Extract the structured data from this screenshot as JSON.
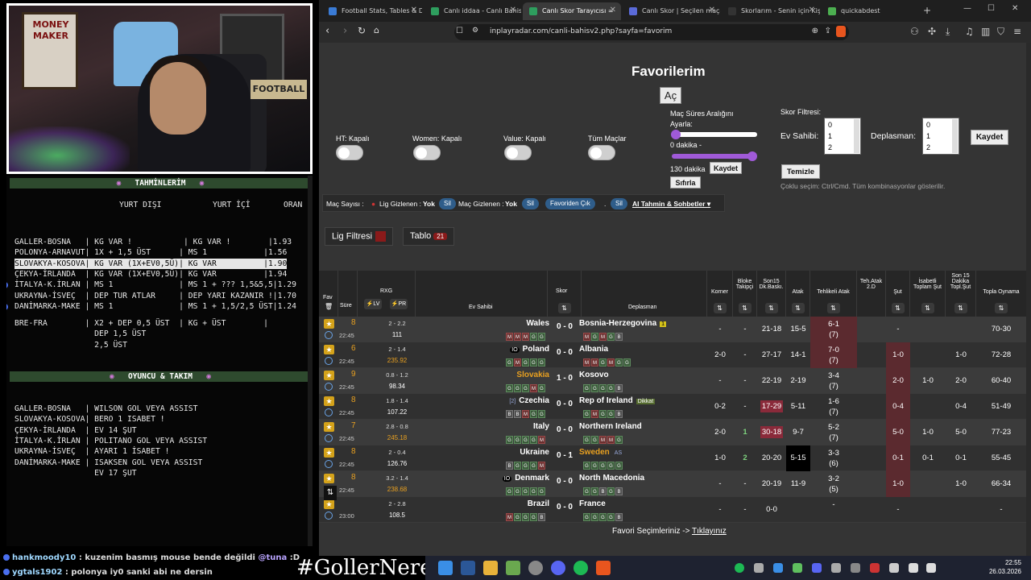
{
  "webcam": {
    "poster_text": "MONEY MAKER",
    "sign_text": "FOOTBALL"
  },
  "terminal": {
    "section1_title": "TAHMİNLERİM",
    "col_yurt_disi": "YURT DIŞI",
    "col_yurt_ici": "YURT İÇİ",
    "col_oran": "ORAN",
    "predictions": [
      {
        "text": "GALLER-BOSNA   | KG VAR !           | KG VAR !        |1.93",
        "hl": false,
        "dot": false
      },
      {
        "text": "POLONYA-ARNAVUT| 1X + 1,5 ÜST      | MS 1            |1.56",
        "hl": false,
        "dot": false
      },
      {
        "text": "SLOVAKYA-KOSOVA| KG VAR (1X+EV0,5Ü)| KG VAR          |1.90",
        "hl": true,
        "dot": false
      },
      {
        "text": "ÇEKYA-İRLANDA  | KG VAR (1X+EV0,5Ü)| KG VAR          |1.94",
        "hl": false,
        "dot": false
      },
      {
        "text": "İTALYA-K.İRLAN | MS 1              | MS 1 + ??? 1,5&5,5|1.29",
        "hl": false,
        "dot": true
      },
      {
        "text": "UKRAYNA-İSVEÇ  | DEP TUR ATLAR     | DEP YARI KAZANIR !|1.70",
        "hl": false,
        "dot": false
      },
      {
        "text": "DANİMARKA-MAKE | MS 1              | MS 1 + 1,5/2,5 ÜST|1.24",
        "hl": false,
        "dot": true
      }
    ],
    "bre_lines": [
      "BRE-FRA        | X2 + DEP 0,5 ÜST  | KG + ÜST        |",
      "                 DEP 1,5 ÜST",
      "                 2,5 ÜST"
    ],
    "section2_title": "OYUNCU & TAKIM",
    "players": [
      "GALLER-BOSNA   | WILSON GOL VEYA ASSIST",
      "SLOVAKYA-KOSOVA| BERO 1 ISABET !",
      "ÇEKYA-İRLANDA  | EV 14 ŞUT",
      "İTALYA-K.İRLAN | POLITANO GOL VEYA ASSIST",
      "UKRAYNA-İSVEÇ  | AYARI 1 İSABET !",
      "DANİMARKA-MAKE | ISAKSEN GOL VEYA ASSIST",
      "                 EV 17 ŞUT"
    ]
  },
  "chat": [
    {
      "nick": "hankmoody10",
      "msg": " : kuzenim basmış mouse bende değildi ",
      "mention": "@tuna",
      "tail": " :D"
    },
    {
      "nick": "ygtals1902",
      "msg": " : polonya iy0 sanki abi ne dersin",
      "mention": "",
      "tail": ""
    }
  ],
  "hashtag": "#GollerNerede",
  "browser": {
    "tabs": [
      {
        "label": "Football Stats, Tables & D",
        "color": "#3a7bd5"
      },
      {
        "label": "Canlı iddaa - Canlı Bahis",
        "color": "#2e9e5e"
      },
      {
        "label": "Canlı Skor Tarayıcısı =",
        "color": "#2e9e5e"
      },
      {
        "label": "Canlı Skor | Seçilen maça",
        "color": "#5a6ad8"
      },
      {
        "label": "Skorlarım - Senin için Kişi",
        "color": "#333"
      },
      {
        "label": "quickabdest",
        "color": "#4caf50"
      }
    ],
    "url": "inplayradar.com/canli-bahisv2.php?sayfa=favorim"
  },
  "page": {
    "title": "Favorilerim",
    "open_btn": "Aç",
    "toggles": [
      "HT: Kapalı",
      "Women: Kapalı",
      "Value: Kapalı",
      "Tüm Maçlar"
    ],
    "range_title": "Maç Süres Aralığını",
    "range_sub": "Ayarla:",
    "range_min": "0 dakika -",
    "range_max": "130 dakika",
    "save1": "Kaydet",
    "reset": "Sıfırla",
    "score_filter": "Skor Filtresi:",
    "home_label": "Ev Sahibi:",
    "away_label": "Deplasman:",
    "list_vals": [
      "0",
      "1",
      "2"
    ],
    "save2": "Kaydet",
    "clear": "Temizle",
    "multi_hint": "Çoklu seçim: Ctrl/Cmd. Tüm kombinasyonlar gösterilir.",
    "filter_bar": {
      "mac_sayisi": "Maç Sayısı :",
      "lig_gizlenen": "Lig Gizlenen :",
      "yok1": "Yok",
      "sil": "Sil",
      "mac_gizlenen": "Maç Gizlenen :",
      "yok2": "Yok",
      "favori_cik": "Favoriden Çık",
      "ai": "AI Tahmin & Sohbetler ▾"
    },
    "lig_filtresi": "Lig Filtresi",
    "tablo": "Tablo",
    "tablo_count": "21",
    "headers": {
      "fav": "Fav",
      "sure": "Süre",
      "rxg": "RXG",
      "lv": "⚡LV",
      "pr": "⚡PR",
      "ev": "Ev Sahibi",
      "skor": "Skor",
      "dep": "Deplasman",
      "korner": "Korner",
      "bloke": "Bloke Takipçi",
      "son15": "Son15 Dk.Baskı.",
      "atak": "Atak",
      "tehlikeli": "Tehlikeli Atak",
      "teh2d": "Teh.Atak 2.D",
      "sut": "Şut",
      "isabetli": "İsabetli Toplam Şut",
      "son15sut": "Son 15 Dakika Topl.Şut",
      "topla": "Topla Oynama"
    },
    "matches": [
      {
        "min": "8",
        "time": "22:45",
        "rxg1": "2 - 2.2",
        "rxg2": "111",
        "rxgc": "#fff",
        "home": "Wales",
        "homec": "#fff",
        "homebadge": "",
        "score": "0 - 0",
        "away": "Bosnia-Herzegovina",
        "awayc": "#fff",
        "awaybadge": "1",
        "hf": "MMMGG",
        "af": "MGMGB",
        "korner": "-",
        "bloke": "-",
        "son15": "21-18",
        "atak": "15-5",
        "teh1": "6-1",
        "teh2": "(7)",
        "sut": "-",
        "isab": "",
        "s15": "",
        "topla": "70-30"
      },
      {
        "min": "6",
        "time": "22:45",
        "rxg1": "2 - 1.4",
        "rxg2": "235.92",
        "rxgc": "#e8a020",
        "home": "Poland",
        "homec": "#fff",
        "homebadge": "IO",
        "score": "0 - 0",
        "away": "Albania",
        "awayc": "#fff",
        "awaybadge": "",
        "hf": "GMGGG",
        "af": "MMGMGG",
        "korner": "2-0",
        "bloke": "-",
        "son15": "27-17",
        "atak": "14-1",
        "teh1": "7-0",
        "teh2": "(7)",
        "sut": "1-0",
        "isab": "",
        "s15": "1-0",
        "topla": "72-28"
      },
      {
        "min": "9",
        "time": "22:45",
        "rxg1": "0.8 - 1.2",
        "rxg2": "98.34",
        "rxgc": "#fff",
        "home": "Slovakia",
        "homec": "#e8a020",
        "homebadge": "",
        "score": "1 - 0",
        "away": "Kosovo",
        "awayc": "#fff",
        "awaybadge": "",
        "hf": "GGGMG",
        "af": "GGGGB",
        "korner": "-",
        "bloke": "-",
        "son15": "22-19",
        "atak": "2-19",
        "teh1": "3-4",
        "teh2": "(7)",
        "sut": "2-0",
        "isab": "1-0",
        "s15": "2-0",
        "topla": "60-40"
      },
      {
        "min": "8",
        "time": "22:45",
        "rxg1": "1.8 - 1.4",
        "rxg2": "107.22",
        "rxgc": "#fff",
        "home": "Czechia",
        "homec": "#fff",
        "homebadge": "[2]",
        "score": "0 - 0",
        "away": "Rep of Ireland",
        "awayc": "#fff",
        "awaybadge": "Dikkat",
        "hf": "BBMGG",
        "af": "GMGGB",
        "korner": "0-2",
        "bloke": "-",
        "son15": "17-29",
        "atak": "5-11",
        "teh1": "1-6",
        "teh2": "(7)",
        "sut": "0-4",
        "isab": "",
        "s15": "0-4",
        "topla": "51-49"
      },
      {
        "min": "7",
        "time": "22:45",
        "rxg1": "2.8 - 0.8",
        "rxg2": "245.18",
        "rxgc": "#e8a020",
        "home": "Italy",
        "homec": "#fff",
        "homebadge": "",
        "score": "0 - 0",
        "away": "Northern Ireland",
        "awayc": "#fff",
        "awaybadge": "",
        "hf": "GGGGM",
        "af": "GGMMG",
        "korner": "2-0",
        "bloke": "1",
        "son15": "30-18",
        "atak": "9-7",
        "teh1": "5-2",
        "teh2": "(7)",
        "sut": "5-0",
        "isab": "1-0",
        "s15": "5-0",
        "topla": "77-23"
      },
      {
        "min": "8",
        "time": "22:45",
        "rxg1": "2 - 0.4",
        "rxg2": "126.76",
        "rxgc": "#fff",
        "home": "Ukraine",
        "homec": "#fff",
        "homebadge": "",
        "score": "0 - 1",
        "away": "Sweden",
        "awayc": "#e8a020",
        "awaybadge": "AS",
        "hf": "BGGGM",
        "af": "GGGGG",
        "korner": "1-0",
        "bloke": "2",
        "son15": "20-20",
        "atak": "5-15",
        "teh1": "3-3",
        "teh2": "(6)",
        "sut": "0-1",
        "isab": "0-1",
        "s15": "0-1",
        "topla": "55-45"
      },
      {
        "min": "8",
        "time": "22:45",
        "rxg1": "3.2 - 1.4",
        "rxg2": "238.68",
        "rxgc": "#e8a020",
        "home": "Denmark",
        "homec": "#fff",
        "homebadge": "IO",
        "score": "0 - 0",
        "away": "North Macedonia",
        "awayc": "#fff",
        "awaybadge": "",
        "hf": "GGGGG",
        "af": "GGBGB",
        "korner": "-",
        "bloke": "-",
        "son15": "20-19",
        "atak": "11-9",
        "teh1": "3-2",
        "teh2": "(5)",
        "sut": "1-0",
        "isab": "",
        "s15": "1-0",
        "topla": "66-34"
      },
      {
        "min": "",
        "time": "23:00",
        "rxg1": "2 - 2.8",
        "rxg2": "108.5",
        "rxgc": "#fff",
        "home": "Brazil",
        "homec": "#fff",
        "homebadge": "",
        "score": "0 - 0",
        "away": "France",
        "awayc": "#fff",
        "awaybadge": "",
        "hf": "MGGGB",
        "af": "GGGGB",
        "korner": "-",
        "bloke": "-",
        "son15": "0-0",
        "atak": "",
        "teh1": "-",
        "teh2": "",
        "sut": "-",
        "isab": "",
        "s15": "",
        "topla": "-"
      }
    ],
    "footer_text": "Favori Seçimleriniz -> ",
    "footer_link": "Tıklayınız"
  },
  "clock": {
    "time": "22:55",
    "date": "26.03.2026"
  }
}
